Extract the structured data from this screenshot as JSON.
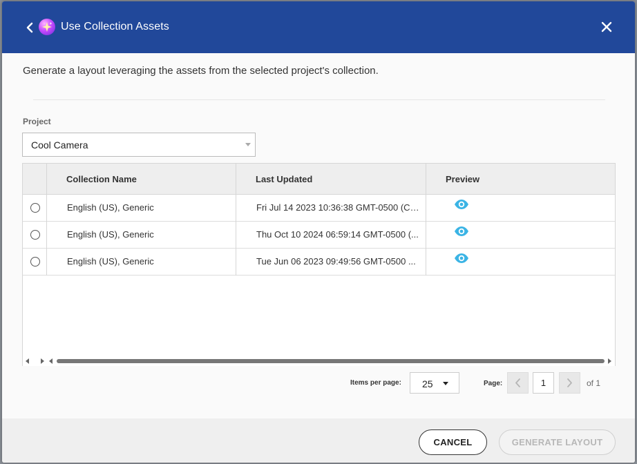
{
  "dialog": {
    "title": "Use Collection Assets",
    "description": "Generate a layout leveraging the assets from the selected project's collection.",
    "back_icon": "chevron-left-icon",
    "logo_icon": "sparkle-logo-icon",
    "close_icon": "close-icon"
  },
  "project": {
    "label": "Project",
    "selected": "Cool Camera"
  },
  "grid": {
    "columns": [
      "Collection Name",
      "Last Updated",
      "Preview"
    ],
    "rows": [
      {
        "name": "English (US), Generic",
        "updated": "Fri Jul 14 2023 10:36:38 GMT-0500 (Ce...",
        "preview_icon": "eye-icon"
      },
      {
        "name": "English (US), Generic",
        "updated": "Thu Oct 10 2024 06:59:14 GMT-0500 (...",
        "preview_icon": "eye-icon"
      },
      {
        "name": "English (US), Generic",
        "updated": "Tue Jun 06 2023 09:49:56 GMT-0500 ...",
        "preview_icon": "eye-icon"
      }
    ]
  },
  "pagination": {
    "items_per_page_label": "Items per page:",
    "items_per_page": "25",
    "page_label": "Page:",
    "current_page": "1",
    "of_text": "of 1"
  },
  "footer": {
    "cancel_label": "CANCEL",
    "generate_label": "GENERATE LAYOUT"
  },
  "colors": {
    "header_bg": "#21489a",
    "accent_eye": "#3bb4e5"
  }
}
